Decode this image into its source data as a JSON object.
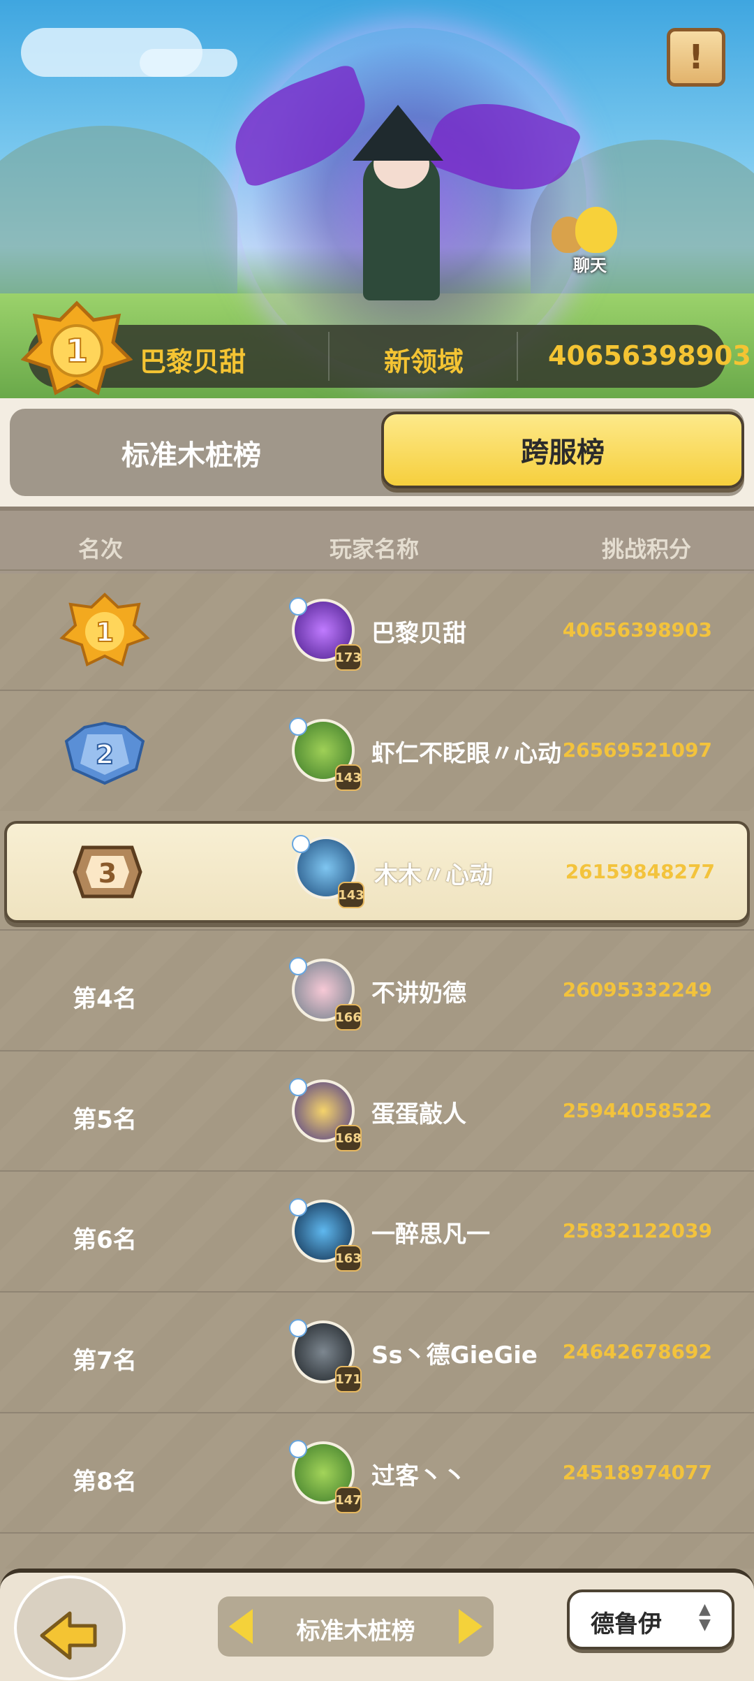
{
  "hero": {
    "chat_label": "聊天",
    "top_player": "巴黎贝甜",
    "top_server": "新领域",
    "top_score": "40656398903",
    "top_rank": "1"
  },
  "tabs": {
    "standard": "标准木桩榜",
    "cross": "跨服榜",
    "active": "cross"
  },
  "header": {
    "rank": "名次",
    "name": "玩家名称",
    "score": "挑战积分"
  },
  "rows": [
    {
      "rank": "1",
      "rank_label": "",
      "name": "巴黎贝甜",
      "score": "40656398903",
      "level": "173"
    },
    {
      "rank": "2",
      "rank_label": "",
      "name": "虾仁不眨眼〃心动",
      "score": "26569521097",
      "level": "143"
    },
    {
      "rank": "3",
      "rank_label": "",
      "name": "木木〃心动",
      "score": "26159848277",
      "level": "143"
    },
    {
      "rank": "4",
      "rank_label": "第4名",
      "name": "不讲奶德",
      "score": "26095332249",
      "level": "166"
    },
    {
      "rank": "5",
      "rank_label": "第5名",
      "name": "蛋蛋敲人",
      "score": "25944058522",
      "level": "168"
    },
    {
      "rank": "6",
      "rank_label": "第6名",
      "name": "一醉思凡一",
      "score": "25832122039",
      "level": "163"
    },
    {
      "rank": "7",
      "rank_label": "第7名",
      "name": "Ss丶德GieGie",
      "score": "24642678692",
      "level": "171"
    },
    {
      "rank": "8",
      "rank_label": "第8名",
      "name": "过客丶丶",
      "score": "24518974077",
      "level": "147"
    }
  ],
  "bottom": {
    "selector": "标准木桩榜",
    "class_select": "德鲁伊",
    "class_arrows": "▲\n▼"
  },
  "colors": {
    "score": "#f3c33c",
    "tab_active": "#f6cf3d",
    "gold_medal": "#f3a91f",
    "silver_medal": "#5a8fd6",
    "bronze_medal": "#b2875a"
  }
}
